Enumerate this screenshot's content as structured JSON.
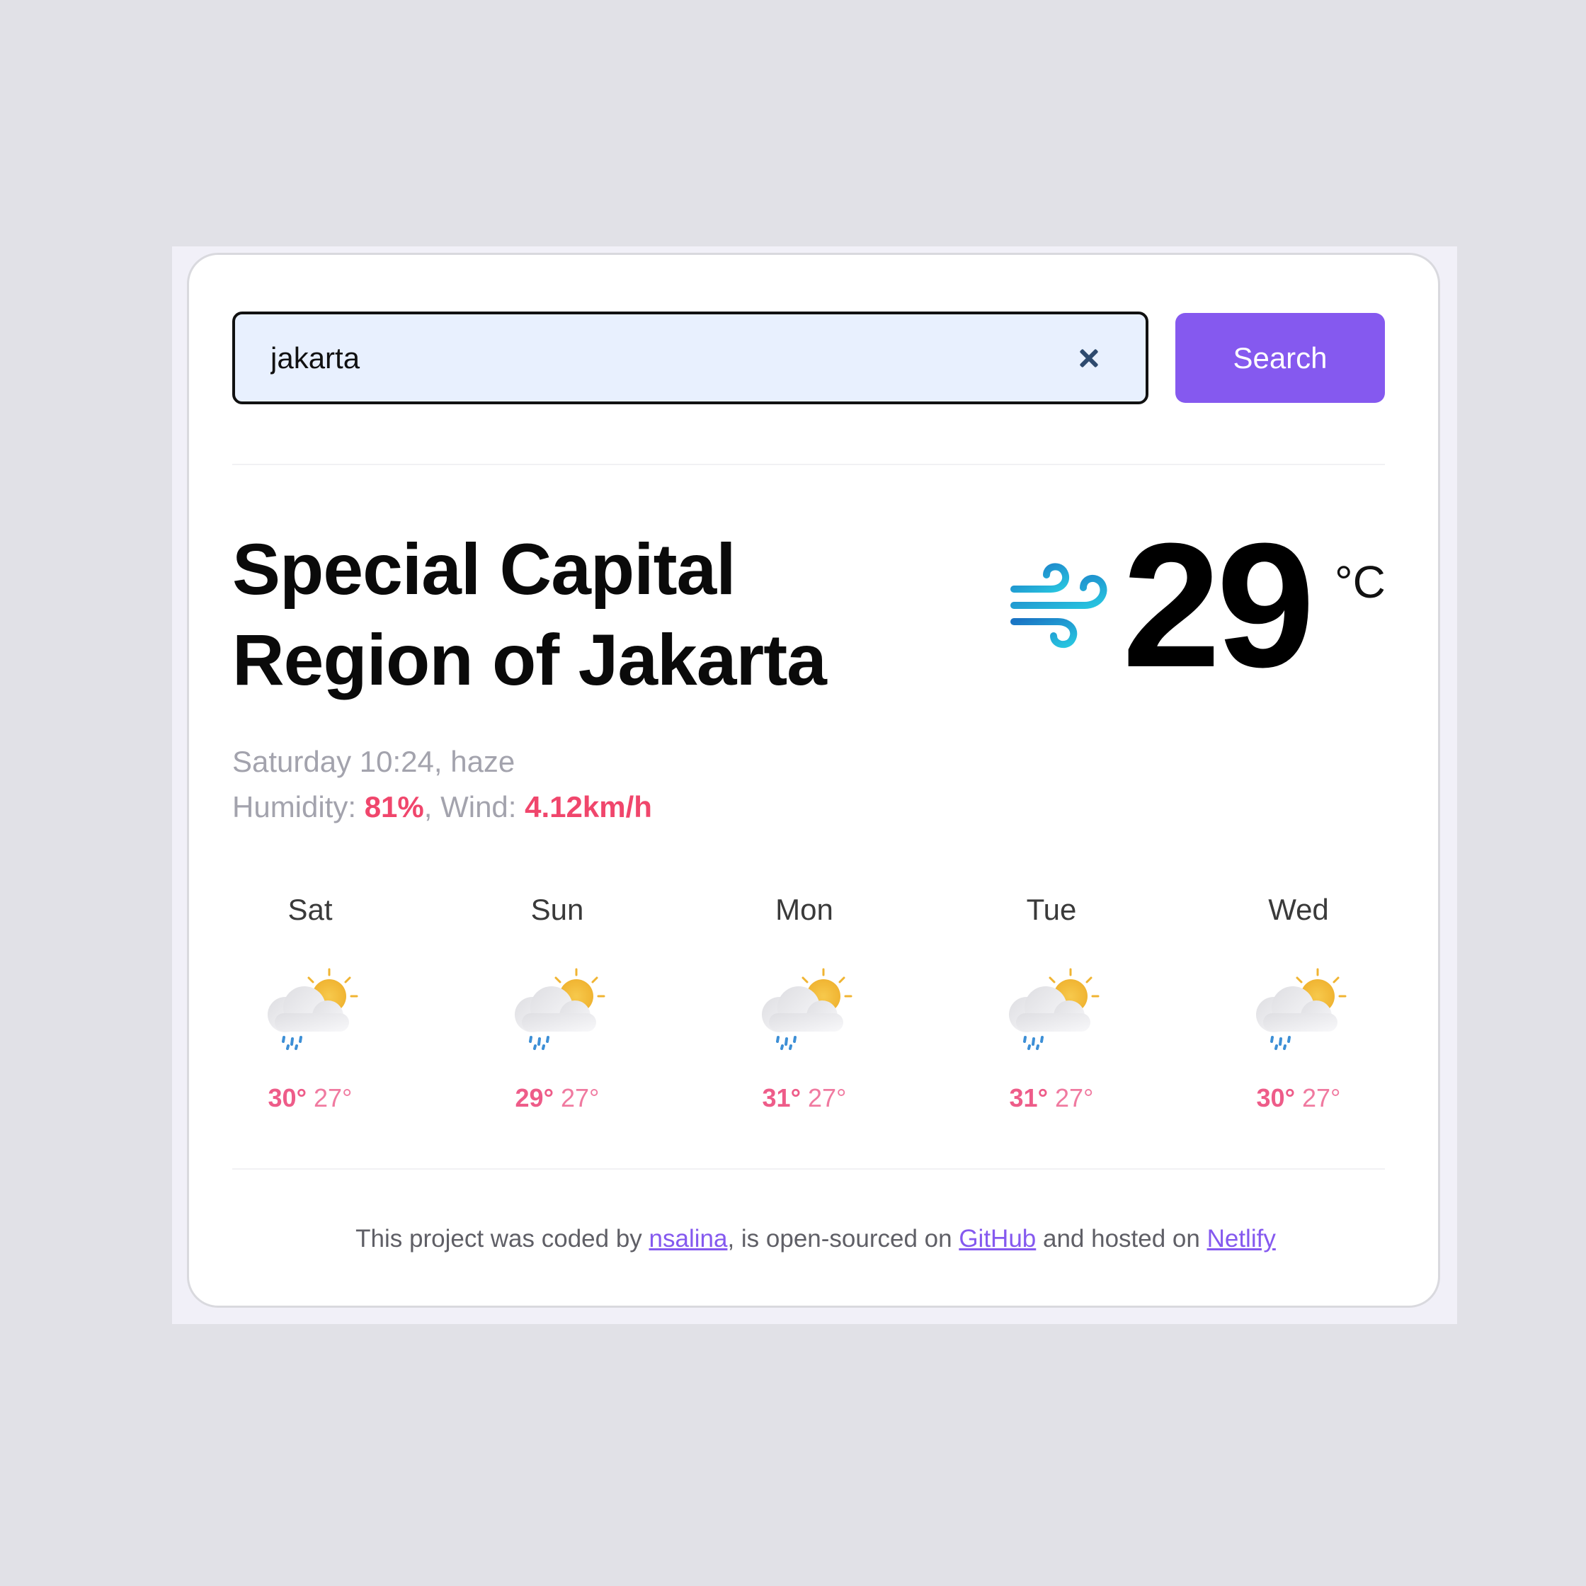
{
  "search": {
    "value": "jakarta",
    "button_label": "Search"
  },
  "current": {
    "city": "Special Capital Region of Jakarta",
    "temperature": "29",
    "unit": "°C",
    "icon": "wind-icon",
    "datetime_description": "Saturday 10:24, haze",
    "humidity_label": "Humidity: ",
    "humidity_value": "81%",
    "wind_label": ", Wind: ",
    "wind_value": "4.12km/h"
  },
  "forecast": [
    {
      "day": "Sat",
      "max": "30°",
      "min": "27°",
      "icon": "partly-cloudy-rain-icon"
    },
    {
      "day": "Sun",
      "max": "29°",
      "min": "27°",
      "icon": "partly-cloudy-rain-icon"
    },
    {
      "day": "Mon",
      "max": "31°",
      "min": "27°",
      "icon": "partly-cloudy-rain-icon"
    },
    {
      "day": "Tue",
      "max": "31°",
      "min": "27°",
      "icon": "partly-cloudy-rain-icon"
    },
    {
      "day": "Wed",
      "max": "30°",
      "min": "27°",
      "icon": "partly-cloudy-rain-icon"
    }
  ],
  "footer": {
    "text_1": "This project was coded by ",
    "link_author": "nsalina",
    "text_2": ", is open-sourced on ",
    "link_github": "GitHub",
    "text_3": " and hosted on ",
    "link_netlify": "Netlify"
  },
  "colors": {
    "accent": "#8559ef",
    "highlight": "#f0466c",
    "input_bg": "#e8f0fe"
  }
}
